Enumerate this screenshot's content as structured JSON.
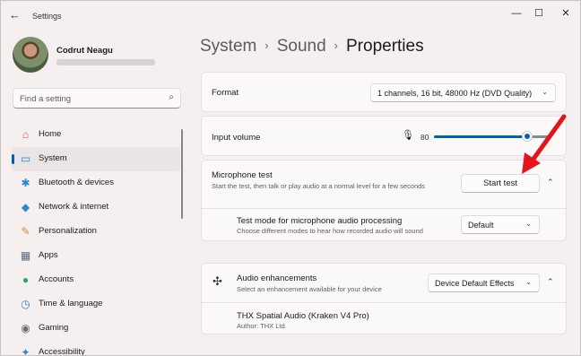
{
  "window": {
    "title": "Settings",
    "back_glyph": "←",
    "minimize_glyph": "—",
    "maximize_glyph": "☐",
    "close_glyph": "✕"
  },
  "user": {
    "name": "Codrut Neagu"
  },
  "search": {
    "placeholder": "Find a setting",
    "icon_glyph": "⌕"
  },
  "sidebar": {
    "items": [
      {
        "label": "Home",
        "icon": "home-icon",
        "glyph": "⌂",
        "color": "#d9534f",
        "active": false
      },
      {
        "label": "System",
        "icon": "monitor-icon",
        "glyph": "▭",
        "color": "#1e88d6",
        "active": true
      },
      {
        "label": "Bluetooth & devices",
        "icon": "bluetooth-icon",
        "glyph": "✱",
        "color": "#1e88d6",
        "active": false
      },
      {
        "label": "Network & internet",
        "icon": "wifi-icon",
        "glyph": "◆",
        "color": "#2f86d4",
        "active": false
      },
      {
        "label": "Personalization",
        "icon": "brush-icon",
        "glyph": "✎",
        "color": "#d98b2b",
        "active": false
      },
      {
        "label": "Apps",
        "icon": "apps-icon",
        "glyph": "▦",
        "color": "#5a6b7b",
        "active": false
      },
      {
        "label": "Accounts",
        "icon": "person-icon",
        "glyph": "●",
        "color": "#2ea36b",
        "active": false
      },
      {
        "label": "Time & language",
        "icon": "globe-icon",
        "glyph": "◷",
        "color": "#2f86d4",
        "active": false
      },
      {
        "label": "Gaming",
        "icon": "gamepad-icon",
        "glyph": "◉",
        "color": "#6d6d6d",
        "active": false
      },
      {
        "label": "Accessibility",
        "icon": "accessibility-icon",
        "glyph": "✦",
        "color": "#2f86d4",
        "active": false
      }
    ]
  },
  "breadcrumb": {
    "part1": "System",
    "part2": "Sound",
    "current": "Properties",
    "sep": "›"
  },
  "format": {
    "label": "Format",
    "value": "1 channels, 16 bit, 48000 Hz (DVD Quality)"
  },
  "input_volume": {
    "label": "Input volume",
    "value": "80",
    "level": 0.8,
    "mic_glyph": "🎙"
  },
  "mic_test": {
    "label": "Microphone test",
    "description": "Start the test, then talk or play audio at a normal level for a few seconds",
    "button": "Start test"
  },
  "test_mode": {
    "label": "Test mode for microphone audio processing",
    "description": "Choose different modes to hear how recorded audio will sound",
    "value": "Default"
  },
  "enhancements": {
    "label": "Audio enhancements",
    "description": "Select an enhancement available for your device",
    "value": "Device Default Effects",
    "icon_glyph": "✣"
  },
  "thx": {
    "name": "THX Spatial Audio (Kraken V4 Pro)",
    "author": "Author: THX Ltd."
  },
  "glyphs": {
    "chevron_down": "⌄",
    "chevron_up": "⌃"
  },
  "colors": {
    "accent": "#005fb8",
    "annotation_arrow": "#e3141b"
  }
}
